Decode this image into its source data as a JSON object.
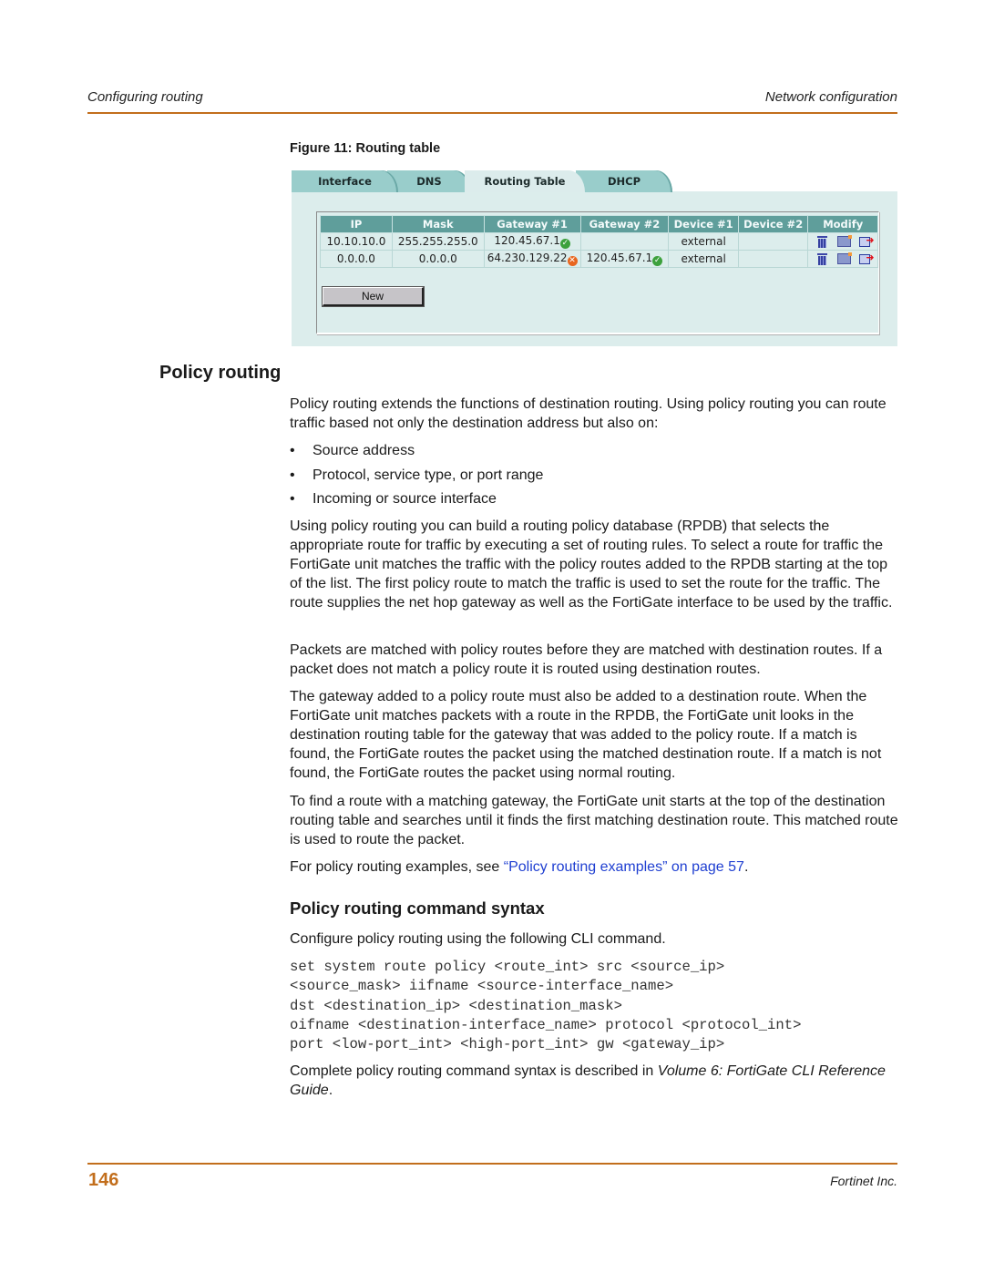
{
  "header": {
    "left": "Configuring routing",
    "right": "Network configuration"
  },
  "figure": {
    "caption": "Figure 11: Routing table",
    "tabs": [
      {
        "label": "Interface",
        "active": false
      },
      {
        "label": "DNS",
        "active": false
      },
      {
        "label": "Routing Table",
        "active": true
      },
      {
        "label": "DHCP",
        "active": false
      }
    ],
    "table": {
      "columns": [
        "IP",
        "Mask",
        "Gateway #1",
        "Gateway #2",
        "Device #1",
        "Device #2",
        "Modify"
      ],
      "rows": [
        {
          "ip": "10.10.10.0",
          "mask": "255.255.255.0",
          "gw1": "120.45.67.1",
          "gw1_status": "ok",
          "gw2": "",
          "gw2_status": "",
          "dev1": "external",
          "dev2": ""
        },
        {
          "ip": "0.0.0.0",
          "mask": "0.0.0.0",
          "gw1": "64.230.129.22",
          "gw1_status": "down",
          "gw2": "120.45.67.1",
          "gw2_status": "ok",
          "dev1": "external",
          "dev2": ""
        }
      ],
      "modify_icons": [
        "delete-icon",
        "edit-icon",
        "move-icon"
      ]
    },
    "new_button": "New",
    "colors": {
      "tab": "#99cdcb",
      "panel": "#dcedec",
      "header": "#5f9e9b",
      "ok": "#3da13d",
      "down": "#e8661f"
    }
  },
  "section": {
    "title": "Policy routing",
    "intro": "Policy routing extends the functions of destination routing. Using policy routing you can route traffic based not only the destination address but also on:",
    "bullets": [
      "Source address",
      "Protocol, service type, or port range",
      "Incoming or source interface"
    ],
    "p1": "Using policy routing you can build a routing policy database (RPDB) that selects the appropriate route for traffic by executing a set of routing rules. To select a route for traffic the FortiGate unit matches the traffic with the policy routes added to the RPDB starting at the top of the list. The first policy route to match the traffic is used to set the route for the traffic. The route supplies the net hop gateway as well as the FortiGate interface to be used by the traffic.",
    "p2": "Packets are matched with policy routes before they are matched with destination routes. If a packet does not match a policy route it is routed using destination routes.",
    "p3": "The gateway added to a policy route must also be added to a destination route. When the FortiGate unit matches packets with a route in the RPDB, the FortiGate unit looks in the destination routing table for the gateway that was added to the policy route. If a match is found, the FortiGate routes the packet using the matched destination route. If a match is not found, the FortiGate routes the packet using normal routing.",
    "p4": "To find a route with a matching gateway, the FortiGate unit starts at the top of the destination routing table and searches until it finds the first matching destination route. This matched route is used to route the packet.",
    "p5_prefix": "For policy routing examples, see ",
    "p5_link": "“Policy routing examples” on page 57",
    "p5_suffix": "."
  },
  "subsection": {
    "title": "Policy routing command syntax",
    "intro": "Configure policy routing using the following CLI command.",
    "code_lines": [
      "set system route policy <route_int> src <source_ip>",
      "<source_mask> iifname <source-interface_name>",
      "dst <destination_ip> <destination_mask>",
      "oifname <destination-interface_name> protocol <protocol_int>",
      "port <low-port_int> <high-port_int> gw <gateway_ip>"
    ],
    "outro_prefix": "Complete policy routing command syntax is described in ",
    "outro_ref": "Volume 6: FortiGate CLI Reference Guide",
    "outro_suffix": "."
  },
  "footer": {
    "page_number": "146",
    "company": "Fortinet Inc."
  }
}
